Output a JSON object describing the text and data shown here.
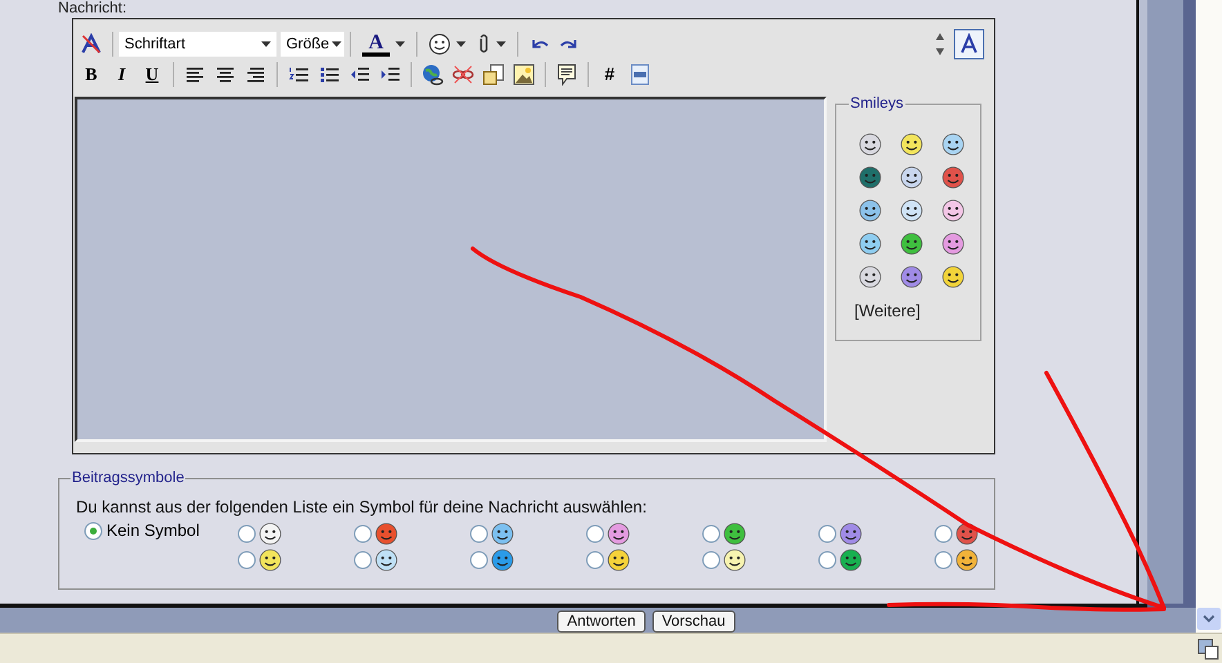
{
  "message_label": "Nachricht:",
  "toolbar": {
    "font_select": "Schriftart",
    "size_select": "Größe",
    "font_color_letter": "A",
    "bold": "B",
    "italic": "I",
    "underline": "U",
    "hash": "#"
  },
  "smileys": {
    "title": "Smileys",
    "more_link": "[Weitere]"
  },
  "post_icons": {
    "title": "Beitragssymbole",
    "instruction": "Du kannst aus der folgenden Liste ein Symbol für deine Nachricht auswählen:",
    "none_option": {
      "label": "Kein Symbol",
      "selected": true
    },
    "options": [
      {
        "selected": false
      },
      {
        "selected": false
      },
      {
        "selected": false
      },
      {
        "selected": false
      },
      {
        "selected": false
      },
      {
        "selected": false
      },
      {
        "selected": false
      },
      {
        "selected": false
      },
      {
        "selected": false
      },
      {
        "selected": false
      },
      {
        "selected": false
      },
      {
        "selected": false
      },
      {
        "selected": false
      },
      {
        "selected": false
      }
    ]
  },
  "buttons": [
    "Antworten",
    "Vorschau"
  ]
}
